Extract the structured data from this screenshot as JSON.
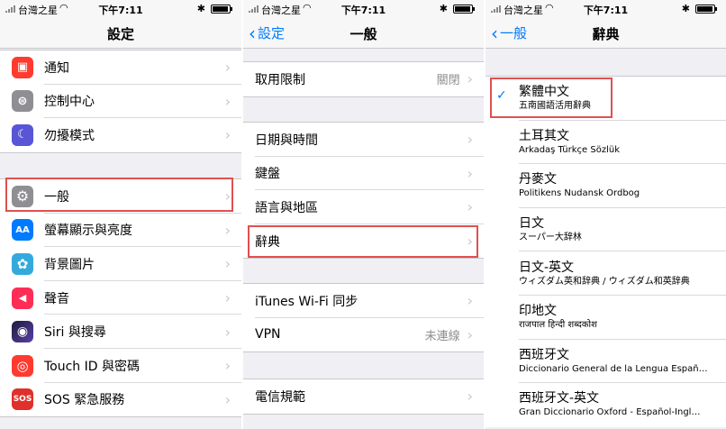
{
  "status": {
    "carrier": "台灣之星",
    "time": "下午7:11"
  },
  "screen1": {
    "title": "設定",
    "group1": [
      {
        "label": "通知",
        "icon": "notifications-icon",
        "color": "#ff3b30",
        "glyph": "▣"
      },
      {
        "label": "控制中心",
        "icon": "control-center-icon",
        "color": "#8e8e93",
        "glyph": "⊜"
      },
      {
        "label": "勿擾模式",
        "icon": "moon-icon",
        "color": "#5856d6",
        "glyph": "☾"
      }
    ],
    "group2": [
      {
        "label": "一般",
        "icon": "gear-icon",
        "color": "#8e8e93",
        "glyph": "⚙"
      },
      {
        "label": "螢幕顯示與亮度",
        "icon": "display-brightness-icon",
        "color": "#007aff",
        "glyph": "AA"
      },
      {
        "label": "背景圖片",
        "icon": "wallpaper-icon",
        "color": "#34aadc",
        "glyph": "✿"
      },
      {
        "label": "聲音",
        "icon": "sound-icon",
        "color": "#ff2d55",
        "glyph": "◀"
      },
      {
        "label": "Siri 與搜尋",
        "icon": "siri-icon",
        "color": "#1c1c3a",
        "glyph": "◉"
      },
      {
        "label": "Touch ID 與密碼",
        "icon": "fingerprint-icon",
        "color": "#ff3b30",
        "glyph": "◎"
      },
      {
        "label": "SOS 緊急服務",
        "icon": "sos-icon",
        "color": "#e0302b",
        "glyph": "SOS"
      }
    ]
  },
  "screen2": {
    "back": "設定",
    "title": "一般",
    "group1": [
      {
        "label": "取用限制",
        "value": "關閉"
      }
    ],
    "group2": [
      {
        "label": "日期與時間",
        "value": ""
      },
      {
        "label": "鍵盤",
        "value": ""
      },
      {
        "label": "語言與地區",
        "value": ""
      },
      {
        "label": "辭典",
        "value": ""
      }
    ],
    "group3": [
      {
        "label": "iTunes Wi-Fi 同步",
        "value": ""
      },
      {
        "label": "VPN",
        "value": "未連線"
      }
    ],
    "group4": [
      {
        "label": "電信規範",
        "value": ""
      }
    ]
  },
  "screen3": {
    "back": "一般",
    "title": "辭典",
    "dictionaries": [
      {
        "name": "繁體中文",
        "sub": "五南國語活用辭典",
        "checked": true
      },
      {
        "name": "土耳其文",
        "sub": "Arkadaş Türkçe Sözlük",
        "checked": false
      },
      {
        "name": "丹麥文",
        "sub": "Politikens Nudansk Ordbog",
        "checked": false
      },
      {
        "name": "日文",
        "sub": "スーパー大辞林",
        "checked": false
      },
      {
        "name": "日文-英文",
        "sub": "ウィズダム英和辞典 / ウィズダム和英辞典",
        "checked": false
      },
      {
        "name": "印地文",
        "sub": "राजपाल हिन्दी शब्दकोश",
        "checked": false
      },
      {
        "name": "西班牙文",
        "sub": "Diccionario General de la Lengua Españ…",
        "checked": false
      },
      {
        "name": "西班牙文-英文",
        "sub": "Gran Diccionario Oxford - Español-Ingl…",
        "checked": false
      }
    ]
  }
}
